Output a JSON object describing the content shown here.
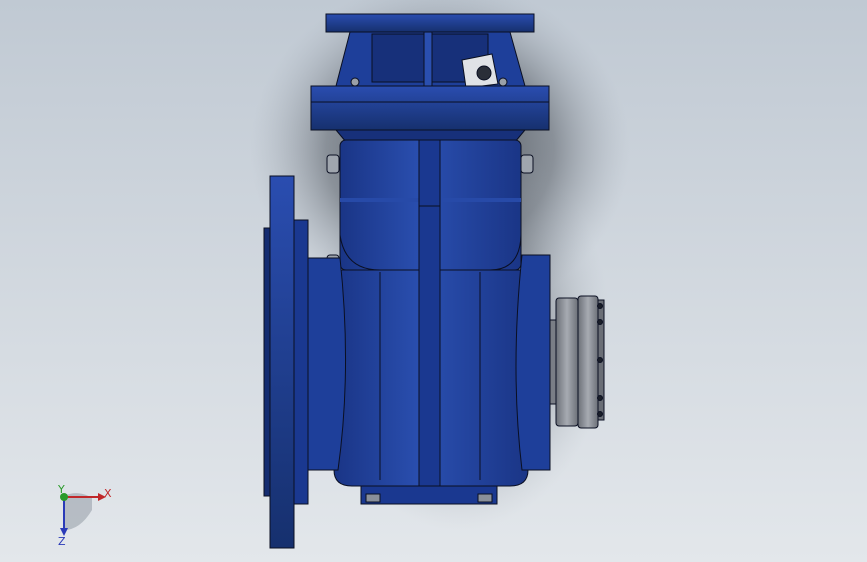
{
  "viewport": {
    "background_top": "#c2cad4",
    "background_bottom": "#e2e6ea"
  },
  "model": {
    "body_color": "#1e3f9a",
    "body_dark": "#142c70",
    "body_light": "#3a63c8",
    "flange_gray": "#8a8e96",
    "edge_color": "#0a0f22"
  },
  "triad": {
    "x_label": "X",
    "y_label": "Y",
    "z_label": "Z",
    "x_color": "#c0282a",
    "y_color": "#2a9a2a",
    "z_color": "#2a3ab8"
  }
}
